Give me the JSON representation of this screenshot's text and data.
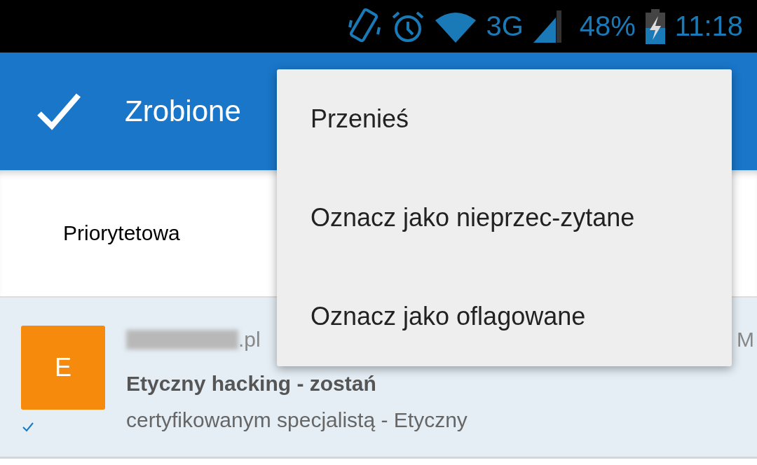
{
  "status_bar": {
    "battery": "48%",
    "time": "11:18",
    "network": "3G"
  },
  "app_bar": {
    "title": "Zrobione"
  },
  "tabs": [
    {
      "label": "Priorytetowa",
      "selected": true
    }
  ],
  "messages": [
    {
      "avatar_letter": "E",
      "sender": ".pl",
      "time": "M",
      "subject": "Etyczny hacking - zostań",
      "preview": "certyfikowanym specjalistą - Etyczny",
      "done": true
    }
  ],
  "menu": {
    "items": [
      {
        "label": "Przenieś"
      },
      {
        "label": "Oznacz jako nieprzec-zytane"
      },
      {
        "label": "Oznacz jako oflagowane"
      }
    ]
  }
}
